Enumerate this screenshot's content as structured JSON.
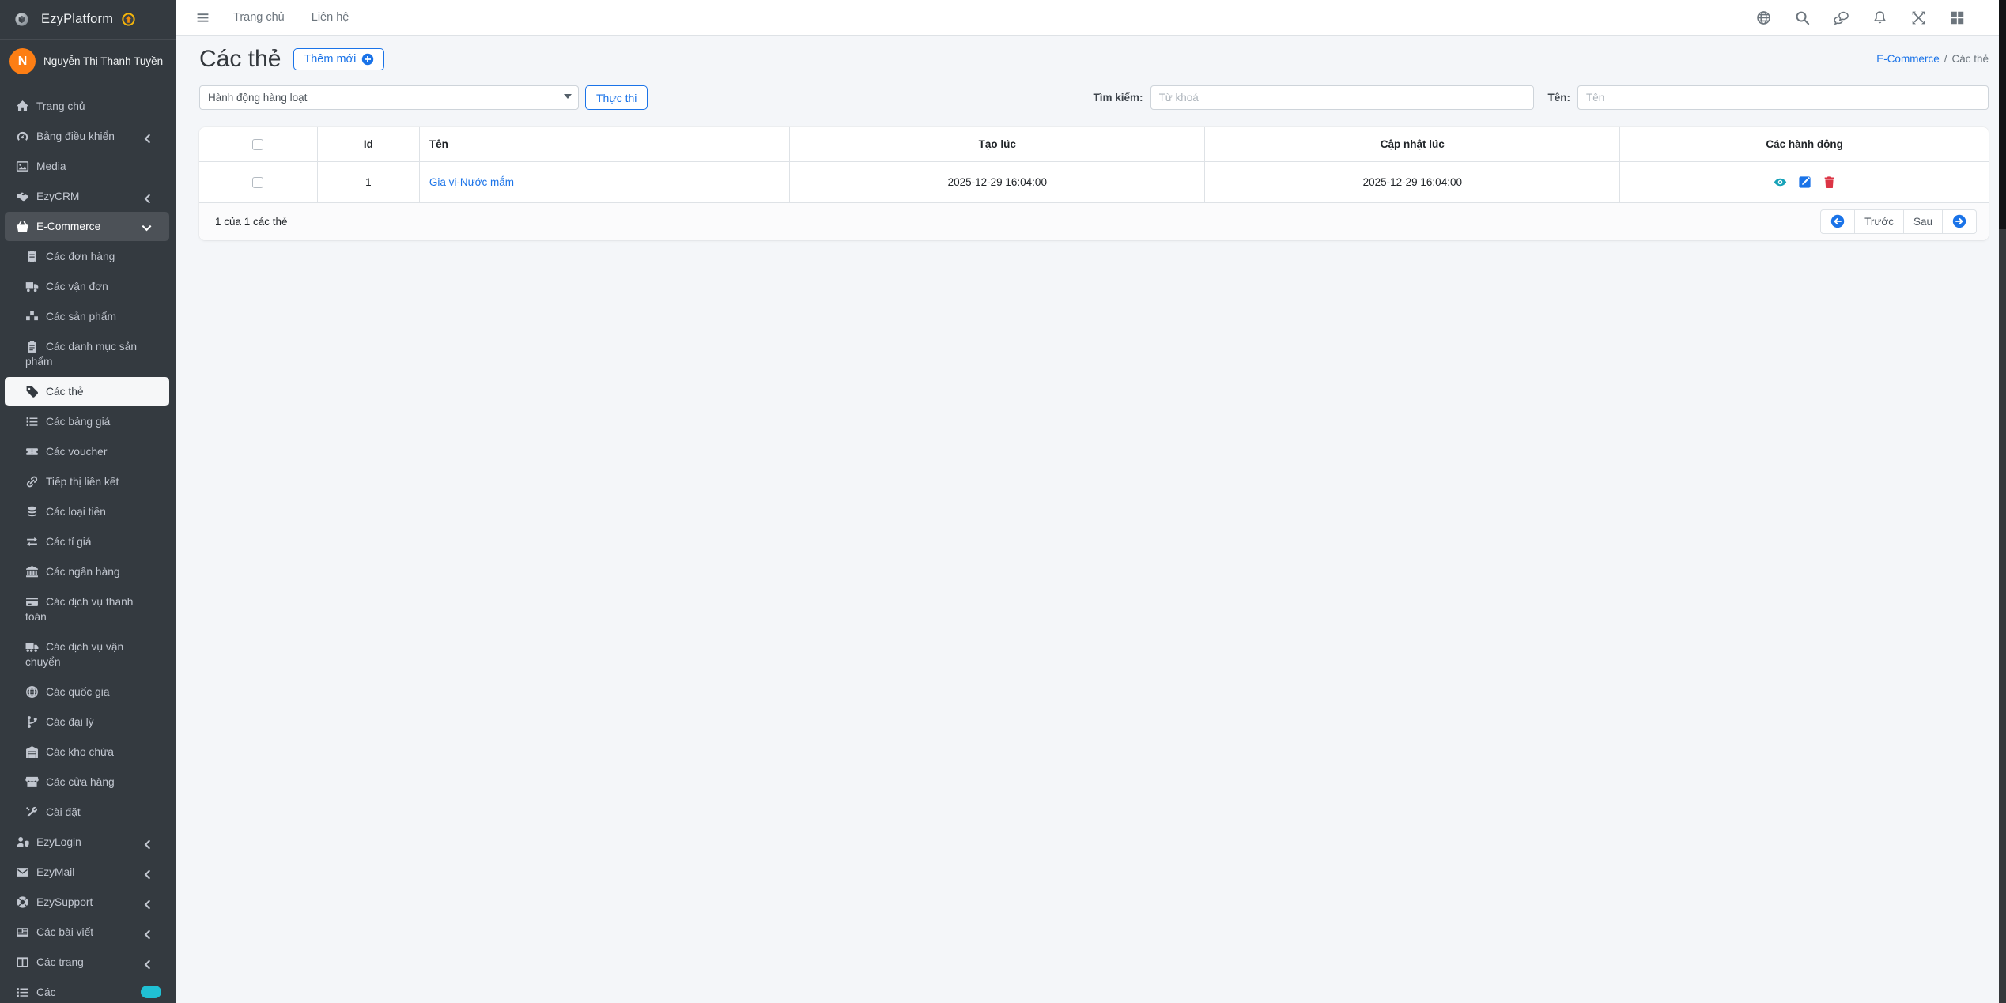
{
  "colors": {
    "accent": "#1a73e8",
    "sidebar_bg": "#343a40",
    "page_bg": "#f4f6f9",
    "avatar_orange": "#fd7e14",
    "badge_teal": "#20c0d4",
    "eye_teal": "#17a2b8",
    "trash_red": "#dc3545",
    "brand_badge_yellow": "#f5b60a"
  },
  "brand": {
    "name": "EzyPlatform",
    "logo_icon": "cube-sphere-logo-icon",
    "badge_icon": "arrow-up-circle-icon"
  },
  "user": {
    "name": "Nguyễn Thị Thanh Tuyền",
    "avatar_initial": "N"
  },
  "navbar": {
    "menu_icon": "hamburger-icon",
    "links": [
      {
        "label": "Trang chủ"
      },
      {
        "label": "Liên hệ"
      }
    ],
    "icons": [
      "globe-icon",
      "search-icon",
      "comments-icon",
      "bell-icon",
      "expand-icon",
      "grid-icon"
    ]
  },
  "sidebar": {
    "items": [
      {
        "label": "Trang chủ",
        "icon": "home-icon",
        "level": 1
      },
      {
        "label": "Bảng điều khiển",
        "icon": "gauge-icon",
        "level": 1,
        "chevron": "left"
      },
      {
        "label": "Media",
        "icon": "image-icon",
        "level": 1
      },
      {
        "label": "EzyCRM",
        "icon": "handshake-icon",
        "level": 1,
        "chevron": "left"
      },
      {
        "label": "E-Commerce",
        "icon": "basket-icon",
        "level": 1,
        "chevron": "down",
        "active": true
      },
      {
        "label": "Các đơn hàng",
        "icon": "receipt-icon",
        "level": 2
      },
      {
        "label": "Các vận đơn",
        "icon": "truck-icon",
        "level": 2
      },
      {
        "label": "Các sản phẩm",
        "icon": "boxes-icon",
        "level": 2
      },
      {
        "label": "Các danh mục sản phẩm",
        "icon": "clipboard-icon",
        "level": 2
      },
      {
        "label": "Các thẻ",
        "icon": "tag-icon",
        "level": 2,
        "active": true
      },
      {
        "label": "Các bảng giá",
        "icon": "list-icon",
        "level": 2
      },
      {
        "label": "Các voucher",
        "icon": "ticket-icon",
        "level": 2
      },
      {
        "label": "Tiếp thị liên kết",
        "icon": "link-icon",
        "level": 2
      },
      {
        "label": "Các loại tiền",
        "icon": "coins-icon",
        "level": 2
      },
      {
        "label": "Các tỉ giá",
        "icon": "exchange-icon",
        "level": 2
      },
      {
        "label": "Các ngân hàng",
        "icon": "bank-icon",
        "level": 2
      },
      {
        "label": "Các dịch vụ thanh toán",
        "icon": "credit-card-icon",
        "level": 2
      },
      {
        "label": "Các dịch vụ vận chuyển",
        "icon": "truck-moving-icon",
        "level": 2
      },
      {
        "label": "Các quốc gia",
        "icon": "globe-icon",
        "level": 2
      },
      {
        "label": "Các đại lý",
        "icon": "branch-icon",
        "level": 2
      },
      {
        "label": "Các kho chứa",
        "icon": "warehouse-icon",
        "level": 2
      },
      {
        "label": "Các cửa hàng",
        "icon": "store-icon",
        "level": 2
      },
      {
        "label": "Cài đặt",
        "icon": "tools-icon",
        "level": 2
      },
      {
        "label": "EzyLogin",
        "icon": "user-shield-icon",
        "level": 1,
        "chevron": "left"
      },
      {
        "label": "EzyMail",
        "icon": "envelope-icon",
        "level": 1,
        "chevron": "left"
      },
      {
        "label": "EzySupport",
        "icon": "life-ring-icon",
        "level": 1,
        "chevron": "left"
      },
      {
        "label": "Các bài viết",
        "icon": "newspaper-icon",
        "level": 1,
        "chevron": "left"
      },
      {
        "label": "Các trang",
        "icon": "columns-icon",
        "level": 1,
        "chevron": "left"
      },
      {
        "label": "Các",
        "icon": "list-icon",
        "level": 1,
        "badge": true,
        "partial": true
      }
    ]
  },
  "page": {
    "title": "Các thẻ",
    "add_button": "Thêm mới",
    "add_button_icon": "plus-circle-icon",
    "breadcrumb": [
      {
        "label": "E-Commerce",
        "link": true
      },
      {
        "label": "Các thẻ",
        "link": false
      }
    ]
  },
  "filters": {
    "bulk_action_selected": "Hành động hàng loạt",
    "execute_button": "Thực thi",
    "search_label": "Tìm kiếm:",
    "search_placeholder": "Từ khoá",
    "name_label": "Tên:",
    "name_placeholder": "Tên"
  },
  "table": {
    "headers": [
      "Id",
      "Tên",
      "Tạo lúc",
      "Cập nhật lúc",
      "Các hành động"
    ],
    "rows": [
      {
        "id": "1",
        "name": "Gia vị-Nước mắm",
        "created_at": "2025-12-29 16:04:00",
        "updated_at": "2025-12-29 16:04:00",
        "actions": [
          "eye-icon",
          "edit-icon",
          "trash-icon"
        ]
      }
    ],
    "footer_text": "1 của 1 các thẻ",
    "pagination": {
      "first_icon": "arrow-circle-left-icon",
      "prev": "Trước",
      "next": "Sau",
      "last_icon": "arrow-circle-right-icon"
    }
  }
}
